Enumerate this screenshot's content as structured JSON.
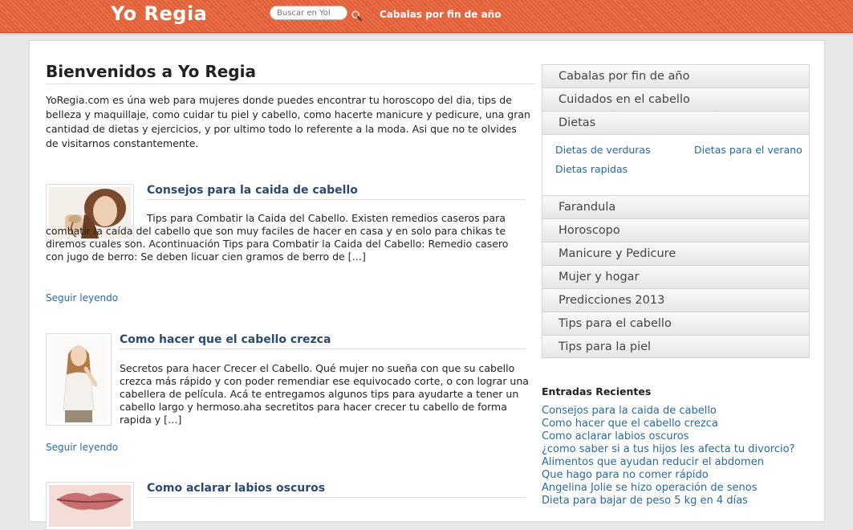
{
  "header": {
    "site_title": "Yo Regia",
    "search_placeholder": "Buscar en Yol",
    "nav_link": "Cabalas por fin de año"
  },
  "main": {
    "page_title": "Bienvenidos a Yo Regia",
    "intro": "YoRegia.com es úna web para mujeres donde puedes encontrar tu horoscopo del dia, tips de belleza y maquillaje, como cuidar tu piel y cabello, como hacerte manicure y pedicure, una gran cantidad de dietas y ejercicios, y por ultimo todo lo referente a la moda. Asi que no te olvides de visitarnos constantemente.",
    "read_more": "Seguir leyendo",
    "posts": [
      {
        "title": "Consejos para la caida de cabello",
        "excerpt": "Tips para Combatir la Caida del Cabello. Existen remedios caseros para combatir la caída del cabello que son muy faciles de hacer en casa y en solo para chikas te diremos cuales son. Acontinuación Tips para Combatir la Caida del Cabello: Remedio casero con jugo de berro: Se deben licuar cien gramos de berro de […]"
      },
      {
        "title": "Como hacer que el cabello crezca",
        "excerpt": "Secretos para hacer Crecer el Cabello. Qué mujer no sueña con que su cabello crezca más rápido y con poder remendiar ese equivocado corte, o con lograr una cabellera de película. Acá te entregamos algunos tips para ayudarte a tener un cabello largo y hermoso.aha  secretitos para hacer crecer tu cabello de forma rapida y […]"
      },
      {
        "title": "Como aclarar labios oscuros"
      }
    ]
  },
  "sidebar": {
    "menu": [
      "Cabalas por fin de año",
      "Cuidados en el cabello",
      "Dietas"
    ],
    "submenu": [
      "Dietas de verduras",
      "Dietas para el verano",
      "Dietas rapidas"
    ],
    "menu_rest": [
      "Farandula",
      "Horoscopo",
      "Manicure y Pedicure",
      "Mujer y hogar",
      "Predicciones 2013",
      "Tips para el cabello",
      "Tips para la piel"
    ],
    "recent_title": "Entradas Recientes",
    "recent": [
      "Consejos para la caida de cabello",
      "Como hacer que el cabello crezca",
      "Como aclarar labios oscuros",
      "¿como saber si a tus hijos les afecta tu divorcio?",
      "Alimentos que ayudan reducir el abdomen",
      "Que hago para no comer rápido",
      "Angelina Jolie se hizo operación de senos",
      "Dieta para bajar de peso 5 kg en 4 días"
    ]
  }
}
